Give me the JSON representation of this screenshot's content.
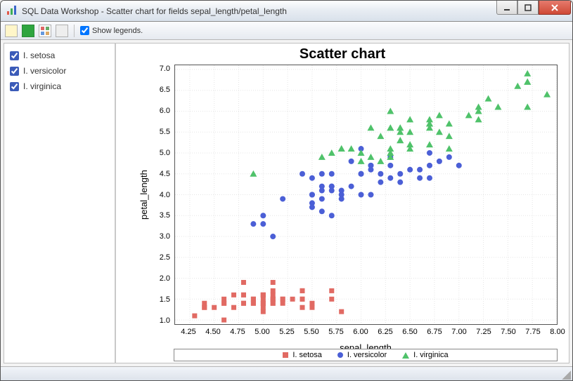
{
  "window": {
    "title": "SQL Data Workshop - Scatter chart for fields sepal_length/petal_length"
  },
  "toolbar": {
    "show_legends_label": "Show legends."
  },
  "sidebar": {
    "items": [
      {
        "label": "I. setosa",
        "checked": true
      },
      {
        "label": "I. versicolor",
        "checked": true
      },
      {
        "label": "I. virginica",
        "checked": true
      }
    ]
  },
  "chart_data": {
    "type": "scatter",
    "title": "Scatter chart",
    "xlabel": "sepal_length",
    "ylabel": "petal_length",
    "xlim": [
      4.1,
      8.0
    ],
    "ylim": [
      0.9,
      7.1
    ],
    "xticks": [
      4.25,
      4.5,
      4.75,
      5.0,
      5.25,
      5.5,
      5.75,
      6.0,
      6.25,
      6.5,
      6.75,
      7.0,
      7.25,
      7.5,
      7.75,
      8.0
    ],
    "yticks": [
      1.0,
      1.5,
      2.0,
      2.5,
      3.0,
      3.5,
      4.0,
      4.5,
      5.0,
      5.5,
      6.0,
      6.5,
      7.0
    ],
    "series": [
      {
        "name": "I. setosa",
        "marker": "square",
        "color": "#e16a63",
        "points": [
          [
            5.1,
            1.4
          ],
          [
            4.9,
            1.4
          ],
          [
            4.7,
            1.3
          ],
          [
            4.6,
            1.5
          ],
          [
            5.0,
            1.4
          ],
          [
            5.4,
            1.7
          ],
          [
            4.6,
            1.4
          ],
          [
            5.0,
            1.5
          ],
          [
            4.4,
            1.4
          ],
          [
            4.9,
            1.5
          ],
          [
            5.4,
            1.5
          ],
          [
            4.8,
            1.6
          ],
          [
            4.8,
            1.4
          ],
          [
            4.3,
            1.1
          ],
          [
            5.8,
            1.2
          ],
          [
            5.7,
            1.5
          ],
          [
            5.4,
            1.3
          ],
          [
            5.1,
            1.4
          ],
          [
            5.7,
            1.7
          ],
          [
            5.1,
            1.5
          ],
          [
            5.4,
            1.7
          ],
          [
            5.1,
            1.5
          ],
          [
            4.6,
            1.0
          ],
          [
            5.1,
            1.7
          ],
          [
            4.8,
            1.9
          ],
          [
            5.0,
            1.6
          ],
          [
            5.0,
            1.6
          ],
          [
            5.2,
            1.5
          ],
          [
            5.2,
            1.4
          ],
          [
            4.7,
            1.6
          ],
          [
            4.8,
            1.6
          ],
          [
            5.4,
            1.5
          ],
          [
            5.2,
            1.5
          ],
          [
            5.5,
            1.4
          ],
          [
            4.9,
            1.5
          ],
          [
            5.0,
            1.2
          ],
          [
            5.5,
            1.3
          ],
          [
            4.9,
            1.4
          ],
          [
            4.4,
            1.3
          ],
          [
            5.1,
            1.5
          ],
          [
            5.0,
            1.3
          ],
          [
            4.5,
            1.3
          ],
          [
            4.4,
            1.3
          ],
          [
            5.0,
            1.6
          ],
          [
            5.1,
            1.9
          ],
          [
            4.8,
            1.4
          ],
          [
            5.1,
            1.6
          ],
          [
            4.6,
            1.4
          ],
          [
            5.3,
            1.5
          ],
          [
            5.0,
            1.4
          ]
        ]
      },
      {
        "name": "I. versicolor",
        "marker": "circle",
        "color": "#4b5fd6",
        "points": [
          [
            7.0,
            4.7
          ],
          [
            6.4,
            4.5
          ],
          [
            6.9,
            4.9
          ],
          [
            5.5,
            4.0
          ],
          [
            6.5,
            4.6
          ],
          [
            5.7,
            4.5
          ],
          [
            6.3,
            4.7
          ],
          [
            4.9,
            3.3
          ],
          [
            6.6,
            4.6
          ],
          [
            5.2,
            3.9
          ],
          [
            5.0,
            3.5
          ],
          [
            5.9,
            4.2
          ],
          [
            6.0,
            4.0
          ],
          [
            6.1,
            4.7
          ],
          [
            5.6,
            3.6
          ],
          [
            6.7,
            4.4
          ],
          [
            5.6,
            4.5
          ],
          [
            5.8,
            4.1
          ],
          [
            6.2,
            4.5
          ],
          [
            5.6,
            3.9
          ],
          [
            5.9,
            4.8
          ],
          [
            6.1,
            4.0
          ],
          [
            6.3,
            4.9
          ],
          [
            6.1,
            4.7
          ],
          [
            6.4,
            4.3
          ],
          [
            6.6,
            4.4
          ],
          [
            6.8,
            4.8
          ],
          [
            6.7,
            5.0
          ],
          [
            6.0,
            4.5
          ],
          [
            5.7,
            3.5
          ],
          [
            5.5,
            3.8
          ],
          [
            5.5,
            3.7
          ],
          [
            5.8,
            3.9
          ],
          [
            6.0,
            5.1
          ],
          [
            5.4,
            4.5
          ],
          [
            6.0,
            4.5
          ],
          [
            6.7,
            4.7
          ],
          [
            6.3,
            4.4
          ],
          [
            5.6,
            4.1
          ],
          [
            5.5,
            4.0
          ],
          [
            5.5,
            4.4
          ],
          [
            6.1,
            4.6
          ],
          [
            5.8,
            4.0
          ],
          [
            5.0,
            3.3
          ],
          [
            5.6,
            4.2
          ],
          [
            5.7,
            4.2
          ],
          [
            5.7,
            4.2
          ],
          [
            6.2,
            4.3
          ],
          [
            5.1,
            3.0
          ],
          [
            5.7,
            4.1
          ]
        ]
      },
      {
        "name": "I. virginica",
        "marker": "triangle",
        "color": "#4fc26a",
        "points": [
          [
            6.3,
            6.0
          ],
          [
            5.8,
            5.1
          ],
          [
            7.1,
            5.9
          ],
          [
            6.3,
            5.6
          ],
          [
            6.5,
            5.8
          ],
          [
            7.6,
            6.6
          ],
          [
            4.9,
            4.5
          ],
          [
            7.3,
            6.3
          ],
          [
            6.7,
            5.8
          ],
          [
            7.2,
            6.1
          ],
          [
            6.5,
            5.1
          ],
          [
            6.4,
            5.3
          ],
          [
            6.8,
            5.5
          ],
          [
            5.7,
            5.0
          ],
          [
            5.8,
            5.1
          ],
          [
            6.4,
            5.3
          ],
          [
            6.5,
            5.5
          ],
          [
            7.7,
            6.7
          ],
          [
            7.7,
            6.9
          ],
          [
            6.0,
            5.0
          ],
          [
            6.9,
            5.7
          ],
          [
            5.6,
            4.9
          ],
          [
            7.7,
            6.7
          ],
          [
            6.3,
            4.9
          ],
          [
            6.7,
            5.7
          ],
          [
            7.2,
            6.0
          ],
          [
            6.2,
            4.8
          ],
          [
            6.1,
            4.9
          ],
          [
            6.4,
            5.6
          ],
          [
            7.2,
            5.8
          ],
          [
            7.4,
            6.1
          ],
          [
            7.9,
            6.4
          ],
          [
            6.4,
            5.6
          ],
          [
            6.3,
            5.1
          ],
          [
            6.1,
            5.6
          ],
          [
            7.7,
            6.1
          ],
          [
            6.3,
            5.6
          ],
          [
            6.4,
            5.5
          ],
          [
            6.0,
            4.8
          ],
          [
            6.9,
            5.4
          ],
          [
            6.7,
            5.6
          ],
          [
            6.9,
            5.1
          ],
          [
            5.8,
            5.1
          ],
          [
            6.8,
            5.9
          ],
          [
            6.7,
            5.7
          ],
          [
            6.7,
            5.2
          ],
          [
            6.3,
            5.0
          ],
          [
            6.5,
            5.2
          ],
          [
            6.2,
            5.4
          ],
          [
            5.9,
            5.1
          ]
        ]
      }
    ],
    "legend": [
      {
        "name": "I. setosa",
        "marker": "square"
      },
      {
        "name": "I. versicolor",
        "marker": "circle"
      },
      {
        "name": "I. virginica",
        "marker": "triangle"
      }
    ]
  }
}
